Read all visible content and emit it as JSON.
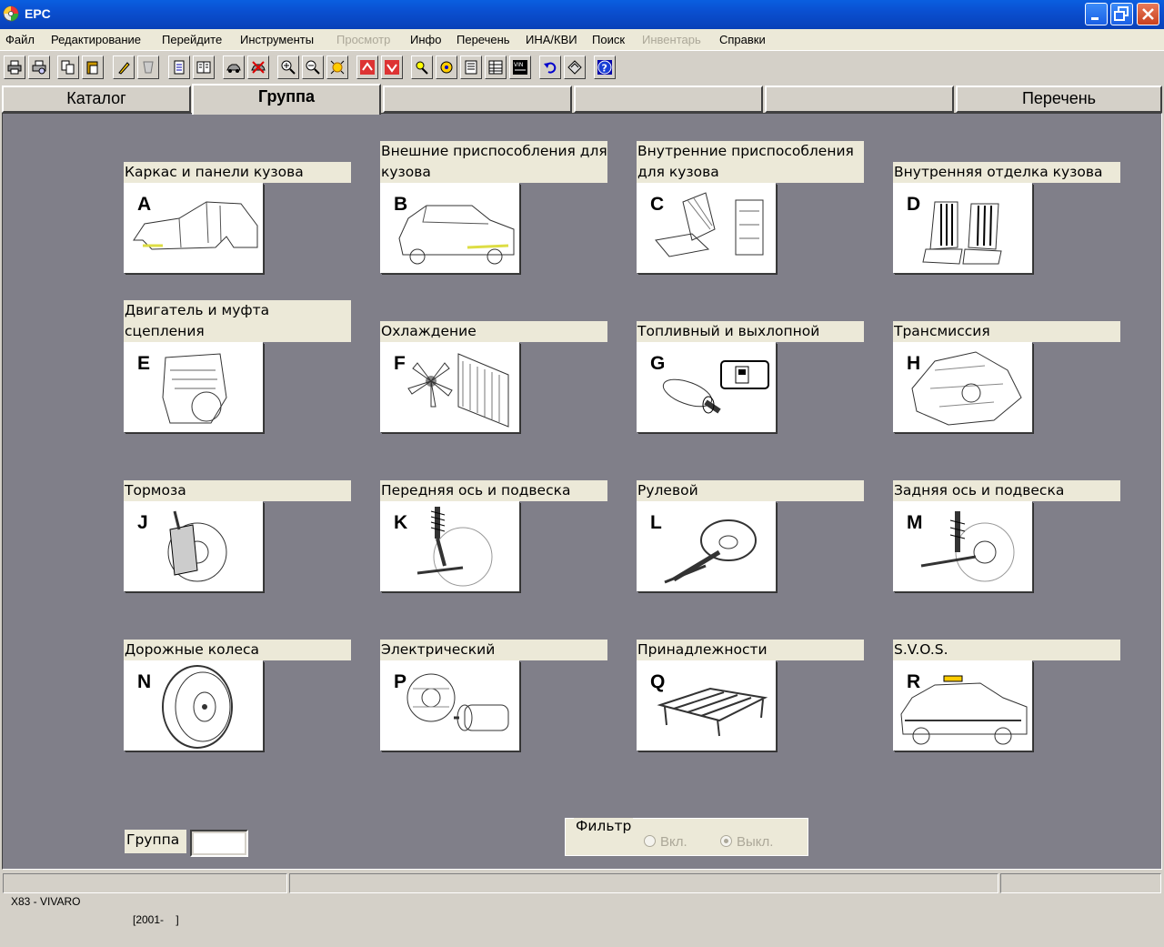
{
  "window": {
    "title": "EPC"
  },
  "menu": [
    {
      "label": "Файл",
      "enabled": true
    },
    {
      "label": "Редактирование",
      "enabled": true
    },
    {
      "label": "Перейдите",
      "enabled": true
    },
    {
      "label": "Инструменты",
      "enabled": true
    },
    {
      "label": "Просмотр",
      "enabled": false
    },
    {
      "label": "Инфо",
      "enabled": true
    },
    {
      "label": "Перечень",
      "enabled": true
    },
    {
      "label": "ИНА/КВИ",
      "enabled": true
    },
    {
      "label": "Поиск",
      "enabled": true
    },
    {
      "label": "Инвентарь",
      "enabled": false
    },
    {
      "label": "Справки",
      "enabled": true
    }
  ],
  "toolbar": {
    "buttons": [
      "print-icon",
      "print-preview-icon",
      "copy-icon",
      "paste-icon",
      "highlight-icon",
      "erase-icon",
      "document-icon",
      "book-icon",
      "car-icon",
      "cross-car-icon",
      "zoom-in-icon",
      "zoom-out-icon",
      "zoom-fit-icon",
      "up-arrow-icon",
      "down-arrow-icon",
      "lamp-icon",
      "tools-icon",
      "list-icon",
      "table-icon",
      "vin-icon",
      "undo-icon",
      "layers-icon",
      "help-icon"
    ],
    "vin_label": "VIN"
  },
  "tabs": [
    {
      "label": "Каталог",
      "active": false
    },
    {
      "label": "Группа",
      "active": true
    },
    {
      "label": "",
      "active": false
    },
    {
      "label": "",
      "active": false
    },
    {
      "label": "",
      "active": false
    },
    {
      "label": "Перечень",
      "active": false
    }
  ],
  "groups": [
    {
      "letter": "A",
      "label": "Каркас и панели кузова",
      "icon": "car-body-icon"
    },
    {
      "letter": "B",
      "label": "Внешние приспособления для кузова",
      "icon": "car-exterior-icon"
    },
    {
      "letter": "C",
      "label": "Внутренние приспособления для кузова",
      "icon": "seat-mechanism-icon"
    },
    {
      "letter": "D",
      "label": "Внутренняя отделка кузова",
      "icon": "seats-icon"
    },
    {
      "letter": "E",
      "label": "Двигатель и муфта сцепления",
      "icon": "engine-icon"
    },
    {
      "letter": "F",
      "label": "Охлаждение",
      "icon": "radiator-fan-icon"
    },
    {
      "letter": "G",
      "label": "Топливный и выхлопной",
      "icon": "exhaust-fuel-icon"
    },
    {
      "letter": "H",
      "label": "Трансмиссия",
      "icon": "gearbox-icon"
    },
    {
      "letter": "J",
      "label": "Тормоза",
      "icon": "brake-icon"
    },
    {
      "letter": "K",
      "label": "Передняя ось и подвеска",
      "icon": "front-suspension-icon"
    },
    {
      "letter": "L",
      "label": "Рулевой",
      "icon": "steering-wheel-icon"
    },
    {
      "letter": "M",
      "label": "Задняя ось и подвеска",
      "icon": "rear-suspension-icon"
    },
    {
      "letter": "N",
      "label": "Дорожные колеса",
      "icon": "wheel-rim-icon"
    },
    {
      "letter": "P",
      "label": "Электрический",
      "icon": "alternator-starter-icon"
    },
    {
      "letter": "Q",
      "label": "Принадлежности",
      "icon": "roof-rack-icon"
    },
    {
      "letter": "R",
      "label": "S.V.O.S.",
      "icon": "police-car-icon"
    }
  ],
  "group_field": {
    "label": "Группа",
    "value": ""
  },
  "filter": {
    "label": "Фильтр",
    "on_label": "Вкл.",
    "off_label": "Выкл.",
    "selected": "off"
  },
  "status": {
    "vehicle": "X83 - VIVARO",
    "years": "[2001-    ]",
    "panel2": "",
    "panel3": ""
  }
}
